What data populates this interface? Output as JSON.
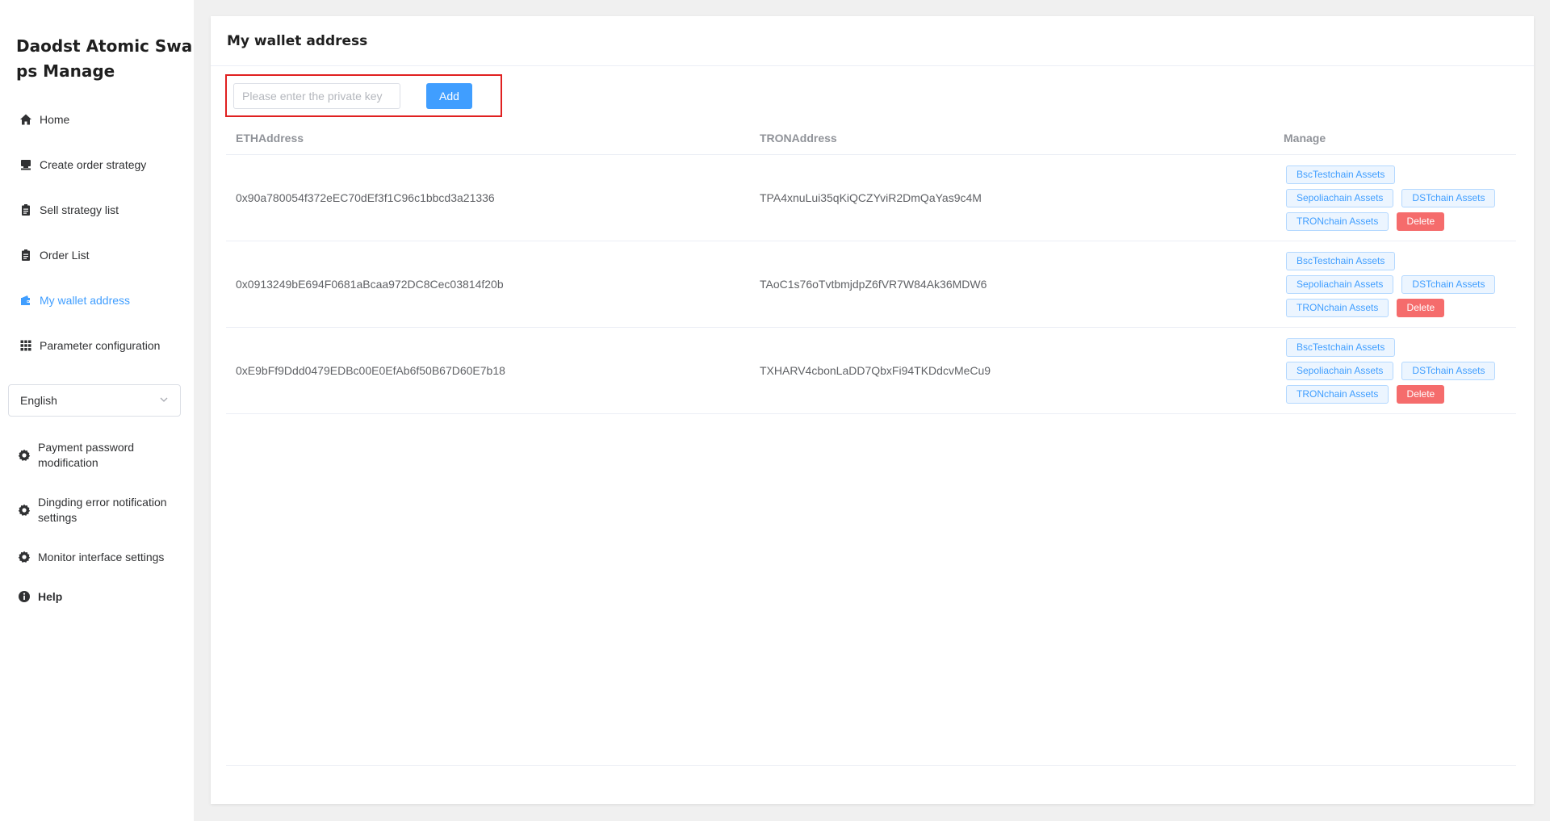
{
  "app": {
    "title": "Daodst Atomic Swaps Manage"
  },
  "sidebar": {
    "items": [
      {
        "label": "Home",
        "icon": "home-icon",
        "active": false
      },
      {
        "label": "Create order strategy",
        "icon": "stamp-icon",
        "active": false
      },
      {
        "label": "Sell strategy list",
        "icon": "clipboard-icon",
        "active": false
      },
      {
        "label": "Order List",
        "icon": "clipboard-icon",
        "active": false
      },
      {
        "label": "My wallet address",
        "icon": "wallet-icon",
        "active": true
      },
      {
        "label": "Parameter configuration",
        "icon": "grid-icon",
        "active": false
      }
    ],
    "language": {
      "selected": "English"
    },
    "settings": [
      {
        "label": "Payment password modification",
        "icon": "gear-icon"
      },
      {
        "label": "Dingding error notification settings",
        "icon": "gear-icon"
      },
      {
        "label": "Monitor interface settings",
        "icon": "gear-icon"
      }
    ],
    "help": {
      "label": "Help",
      "icon": "info-icon"
    }
  },
  "main": {
    "title": "My wallet address",
    "private_key_input": {
      "value": "",
      "placeholder": "Please enter the private key"
    },
    "add_label": "Add",
    "table": {
      "headers": {
        "eth": "ETHAddress",
        "tron": "TRONAddress",
        "manage": "Manage"
      },
      "buttons": {
        "bsc": "BscTestchain Assets",
        "sepolia": "Sepoliachain Assets",
        "dst": "DSTchain Assets",
        "tron": "TRONchain Assets",
        "delete": "Delete"
      },
      "rows": [
        {
          "eth": "0x90a780054f372eEC70dEf3f1C96c1bbcd3a21336",
          "tron": "TPA4xnuLui35qKiQCZYviR2DmQaYas9c4M"
        },
        {
          "eth": "0x0913249bE694F0681aBcaa972DC8Cec03814f20b",
          "tron": "TAoC1s76oTvtbmjdpZ6fVR7W84Ak36MDW6"
        },
        {
          "eth": "0xE9bFf9Ddd0479EDBc00E0EfAb6f50B67D60E7b18",
          "tron": "TXHARV4cbonLaDD7QbxFi94TKDdcvMeCu9"
        }
      ]
    }
  },
  "colors": {
    "accent": "#409eff",
    "danger": "#f56c6c",
    "highlight_box": "#e02020"
  }
}
